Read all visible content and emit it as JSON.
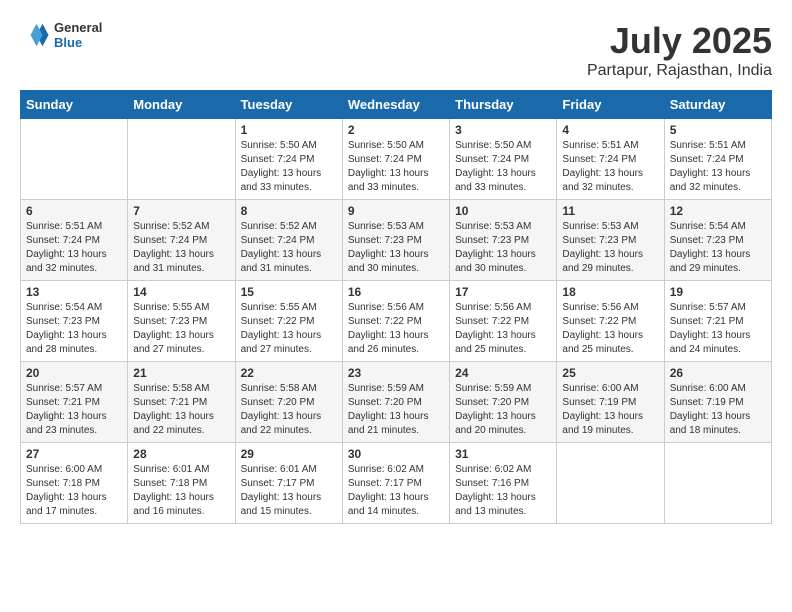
{
  "header": {
    "logo_general": "General",
    "logo_blue": "Blue",
    "month_year": "July 2025",
    "location": "Partapur, Rajasthan, India"
  },
  "weekdays": [
    "Sunday",
    "Monday",
    "Tuesday",
    "Wednesday",
    "Thursday",
    "Friday",
    "Saturday"
  ],
  "weeks": [
    [
      {
        "day": "",
        "info": ""
      },
      {
        "day": "",
        "info": ""
      },
      {
        "day": "1",
        "info": "Sunrise: 5:50 AM\nSunset: 7:24 PM\nDaylight: 13 hours\nand 33 minutes."
      },
      {
        "day": "2",
        "info": "Sunrise: 5:50 AM\nSunset: 7:24 PM\nDaylight: 13 hours\nand 33 minutes."
      },
      {
        "day": "3",
        "info": "Sunrise: 5:50 AM\nSunset: 7:24 PM\nDaylight: 13 hours\nand 33 minutes."
      },
      {
        "day": "4",
        "info": "Sunrise: 5:51 AM\nSunset: 7:24 PM\nDaylight: 13 hours\nand 32 minutes."
      },
      {
        "day": "5",
        "info": "Sunrise: 5:51 AM\nSunset: 7:24 PM\nDaylight: 13 hours\nand 32 minutes."
      }
    ],
    [
      {
        "day": "6",
        "info": "Sunrise: 5:51 AM\nSunset: 7:24 PM\nDaylight: 13 hours\nand 32 minutes."
      },
      {
        "day": "7",
        "info": "Sunrise: 5:52 AM\nSunset: 7:24 PM\nDaylight: 13 hours\nand 31 minutes."
      },
      {
        "day": "8",
        "info": "Sunrise: 5:52 AM\nSunset: 7:24 PM\nDaylight: 13 hours\nand 31 minutes."
      },
      {
        "day": "9",
        "info": "Sunrise: 5:53 AM\nSunset: 7:23 PM\nDaylight: 13 hours\nand 30 minutes."
      },
      {
        "day": "10",
        "info": "Sunrise: 5:53 AM\nSunset: 7:23 PM\nDaylight: 13 hours\nand 30 minutes."
      },
      {
        "day": "11",
        "info": "Sunrise: 5:53 AM\nSunset: 7:23 PM\nDaylight: 13 hours\nand 29 minutes."
      },
      {
        "day": "12",
        "info": "Sunrise: 5:54 AM\nSunset: 7:23 PM\nDaylight: 13 hours\nand 29 minutes."
      }
    ],
    [
      {
        "day": "13",
        "info": "Sunrise: 5:54 AM\nSunset: 7:23 PM\nDaylight: 13 hours\nand 28 minutes."
      },
      {
        "day": "14",
        "info": "Sunrise: 5:55 AM\nSunset: 7:23 PM\nDaylight: 13 hours\nand 27 minutes."
      },
      {
        "day": "15",
        "info": "Sunrise: 5:55 AM\nSunset: 7:22 PM\nDaylight: 13 hours\nand 27 minutes."
      },
      {
        "day": "16",
        "info": "Sunrise: 5:56 AM\nSunset: 7:22 PM\nDaylight: 13 hours\nand 26 minutes."
      },
      {
        "day": "17",
        "info": "Sunrise: 5:56 AM\nSunset: 7:22 PM\nDaylight: 13 hours\nand 25 minutes."
      },
      {
        "day": "18",
        "info": "Sunrise: 5:56 AM\nSunset: 7:22 PM\nDaylight: 13 hours\nand 25 minutes."
      },
      {
        "day": "19",
        "info": "Sunrise: 5:57 AM\nSunset: 7:21 PM\nDaylight: 13 hours\nand 24 minutes."
      }
    ],
    [
      {
        "day": "20",
        "info": "Sunrise: 5:57 AM\nSunset: 7:21 PM\nDaylight: 13 hours\nand 23 minutes."
      },
      {
        "day": "21",
        "info": "Sunrise: 5:58 AM\nSunset: 7:21 PM\nDaylight: 13 hours\nand 22 minutes."
      },
      {
        "day": "22",
        "info": "Sunrise: 5:58 AM\nSunset: 7:20 PM\nDaylight: 13 hours\nand 22 minutes."
      },
      {
        "day": "23",
        "info": "Sunrise: 5:59 AM\nSunset: 7:20 PM\nDaylight: 13 hours\nand 21 minutes."
      },
      {
        "day": "24",
        "info": "Sunrise: 5:59 AM\nSunset: 7:20 PM\nDaylight: 13 hours\nand 20 minutes."
      },
      {
        "day": "25",
        "info": "Sunrise: 6:00 AM\nSunset: 7:19 PM\nDaylight: 13 hours\nand 19 minutes."
      },
      {
        "day": "26",
        "info": "Sunrise: 6:00 AM\nSunset: 7:19 PM\nDaylight: 13 hours\nand 18 minutes."
      }
    ],
    [
      {
        "day": "27",
        "info": "Sunrise: 6:00 AM\nSunset: 7:18 PM\nDaylight: 13 hours\nand 17 minutes."
      },
      {
        "day": "28",
        "info": "Sunrise: 6:01 AM\nSunset: 7:18 PM\nDaylight: 13 hours\nand 16 minutes."
      },
      {
        "day": "29",
        "info": "Sunrise: 6:01 AM\nSunset: 7:17 PM\nDaylight: 13 hours\nand 15 minutes."
      },
      {
        "day": "30",
        "info": "Sunrise: 6:02 AM\nSunset: 7:17 PM\nDaylight: 13 hours\nand 14 minutes."
      },
      {
        "day": "31",
        "info": "Sunrise: 6:02 AM\nSunset: 7:16 PM\nDaylight: 13 hours\nand 13 minutes."
      },
      {
        "day": "",
        "info": ""
      },
      {
        "day": "",
        "info": ""
      }
    ]
  ]
}
